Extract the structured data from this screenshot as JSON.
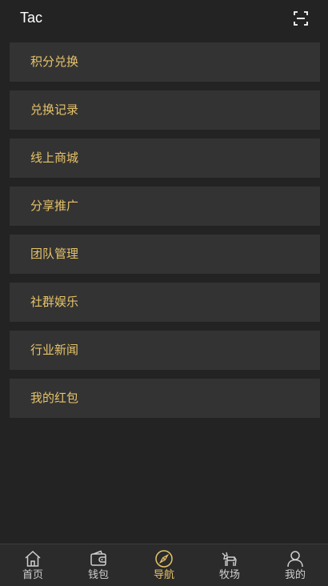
{
  "header": {
    "title": "Tac",
    "scan_icon": "scan-icon"
  },
  "colors": {
    "background": "#232323",
    "card": "#333333",
    "accent": "#e7c36a",
    "tab_inactive": "#cfcfcf"
  },
  "menu": {
    "items": [
      {
        "label": "积分兑换"
      },
      {
        "label": "兑换记录"
      },
      {
        "label": "线上商城"
      },
      {
        "label": "分享推广"
      },
      {
        "label": "团队管理"
      },
      {
        "label": "社群娱乐"
      },
      {
        "label": "行业新闻"
      },
      {
        "label": "我的红包"
      }
    ]
  },
  "tabbar": {
    "active": "导航",
    "tabs": [
      {
        "label": "首页",
        "icon": "home-icon"
      },
      {
        "label": "钱包",
        "icon": "wallet-icon"
      },
      {
        "label": "导航",
        "icon": "compass-icon"
      },
      {
        "label": "牧场",
        "icon": "cow-icon"
      },
      {
        "label": "我的",
        "icon": "user-icon"
      }
    ]
  }
}
